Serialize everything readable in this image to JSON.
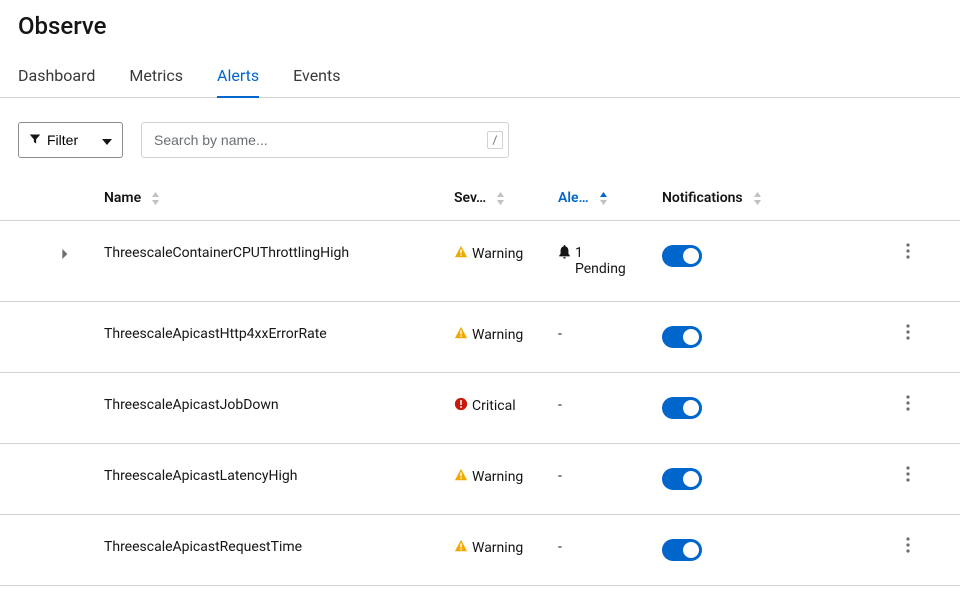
{
  "pageTitle": "Observe",
  "tabs": [
    {
      "label": "Dashboard",
      "active": false
    },
    {
      "label": "Metrics",
      "active": false
    },
    {
      "label": "Alerts",
      "active": true
    },
    {
      "label": "Events",
      "active": false
    }
  ],
  "toolbar": {
    "filterLabel": "Filter",
    "searchPlaceholder": "Search by name...",
    "searchShortcut": "/"
  },
  "columns": {
    "name": "Name",
    "severity": "Sev…",
    "alert": "Ale…",
    "notifications": "Notifications"
  },
  "rows": [
    {
      "name": "ThreescaleContainerCPUThrottlingHigh",
      "severity": {
        "level": "warning",
        "label": "Warning"
      },
      "alert": {
        "count": "1",
        "state": "Pending",
        "hasIcon": true
      },
      "notifications": true,
      "expandable": true
    },
    {
      "name": "ThreescaleApicastHttp4xxErrorRate",
      "severity": {
        "level": "warning",
        "label": "Warning"
      },
      "alert": {
        "label": "-"
      },
      "notifications": true,
      "expandable": false
    },
    {
      "name": "ThreescaleApicastJobDown",
      "severity": {
        "level": "critical",
        "label": "Critical"
      },
      "alert": {
        "label": "-"
      },
      "notifications": true,
      "expandable": false
    },
    {
      "name": "ThreescaleApicastLatencyHigh",
      "severity": {
        "level": "warning",
        "label": "Warning"
      },
      "alert": {
        "label": "-"
      },
      "notifications": true,
      "expandable": false
    },
    {
      "name": "ThreescaleApicastRequestTime",
      "severity": {
        "level": "warning",
        "label": "Warning"
      },
      "alert": {
        "label": "-"
      },
      "notifications": true,
      "expandable": false
    }
  ]
}
